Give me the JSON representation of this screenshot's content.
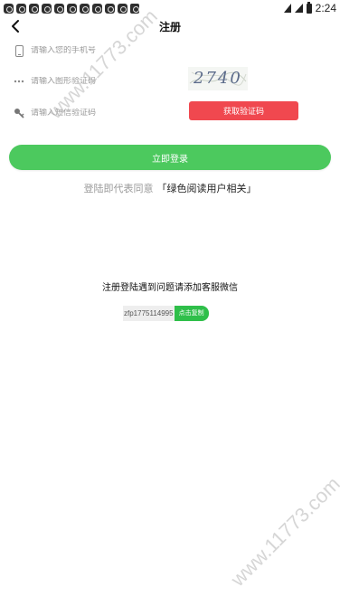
{
  "status_bar": {
    "time": "2:24",
    "notification_count": 11
  },
  "nav": {
    "title": "注册",
    "back_icon": "chevron-left-icon"
  },
  "form": {
    "phone": {
      "icon": "phone-icon",
      "placeholder": "请输入您的手机号"
    },
    "captcha": {
      "icon": "dots-icon",
      "placeholder": "请输入图形验证码",
      "image_text": "2740"
    },
    "sms": {
      "icon": "key-icon",
      "placeholder": "请输入短信验证码",
      "button": "获取验证码"
    }
  },
  "login_button": "立即登录",
  "agreement": {
    "prefix": "登陆即代表同意",
    "link": "「绿色阅读用户相关」"
  },
  "help_text": "注册登陆遇到问题请添加客服微信",
  "wechat": {
    "id": "zfp1775114995",
    "copy_button": "点击复制"
  },
  "watermark": "www.11773.com",
  "colors": {
    "accent_green": "#4cc95e",
    "sms_red": "#f0484f",
    "copy_green": "#2fbf4a"
  }
}
